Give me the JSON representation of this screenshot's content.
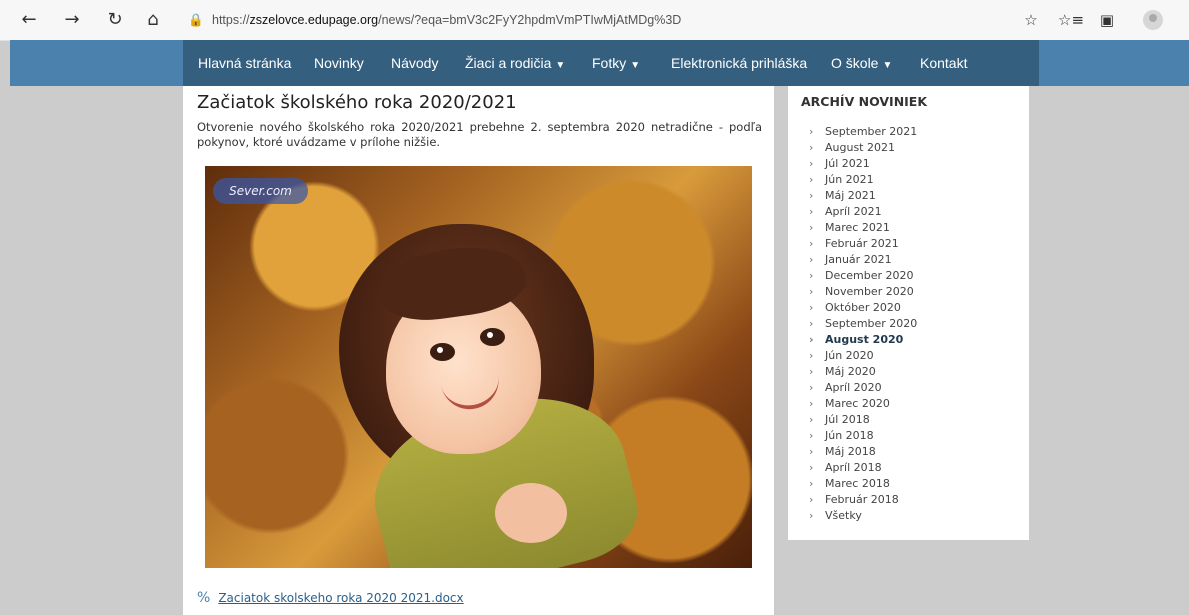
{
  "browser": {
    "back_icon": "←",
    "forward_icon": "→",
    "reload_icon": "↻",
    "home_icon": "⌂",
    "lock_icon": "🔒",
    "url_prefix": "https://",
    "url_domain": "zszelovce.edupage.org",
    "url_path": "/news/?eqa=bmV3c2FyY2hpdmVmPTIwMjAtMDg%3D",
    "favorite_icon": "☆",
    "favorites_icon": "☆≡",
    "collections_icon": "▣"
  },
  "nav": {
    "items": [
      {
        "label": "Hlavná stránka"
      },
      {
        "label": "Novinky"
      },
      {
        "label": "Návody"
      },
      {
        "label": "Žiaci a rodičia",
        "caret": "▼"
      },
      {
        "label": "Fotky",
        "caret": "▼"
      },
      {
        "label": "Elektronická prihláška"
      },
      {
        "label": "O škole",
        "caret": "▼"
      },
      {
        "label": "Kontakt"
      }
    ]
  },
  "article": {
    "title": "Začiatok školského roka 2020/2021",
    "text": "Otvorenie nového školského roka 2020/2021 prebehne 2. septembra 2020 netradične - podľa pokynov, ktoré uvádzame v prílohe nižšie.",
    "watermark_text": "Sever.com",
    "attachment_icon": "%",
    "attachment_name": "Zaciatok skolskeho roka 2020 2021.docx"
  },
  "sidebar": {
    "title": "ARCHÍV NOVINIEK",
    "items": [
      "September 2021",
      "August 2021",
      "Júl 2021",
      "Jún 2021",
      "Máj 2021",
      "Apríl 2021",
      "Marec 2021",
      "Február 2021",
      "Január 2021",
      "December 2020",
      "November 2020",
      "Október 2020",
      "September 2020",
      "August 2020",
      "Jún 2020",
      "Máj 2020",
      "Apríl 2020",
      "Marec 2020",
      "Júl 2018",
      "Jún 2018",
      "Máj 2018",
      "Apríl 2018",
      "Marec 2018",
      "Február 2018",
      "Všetky"
    ],
    "active_item": "August 2020"
  }
}
